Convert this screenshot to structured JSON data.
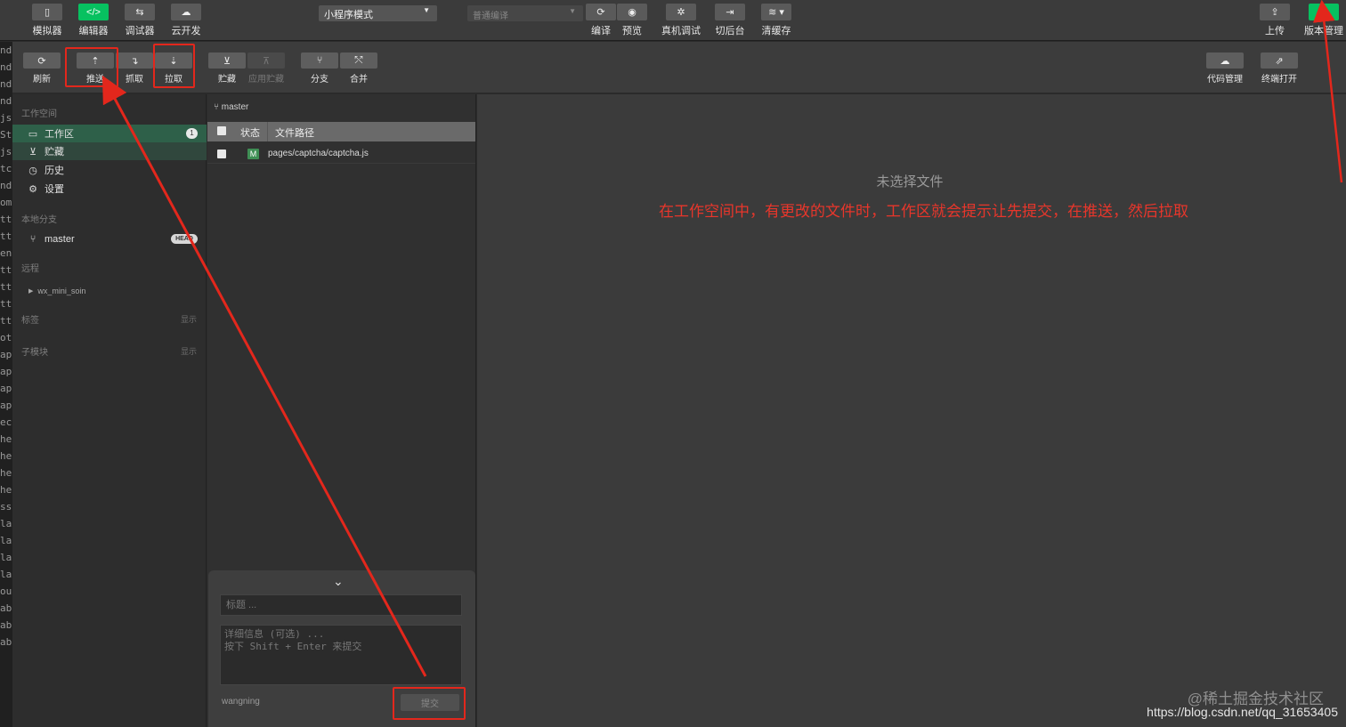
{
  "toolbar": {
    "simulator": "模拟器",
    "editor": "编辑器",
    "debugger": "调试器",
    "cloud": "云开发",
    "mode": "小程序模式",
    "compile_mode": "普通编译",
    "compile": "编译",
    "preview": "预览",
    "remote_debug": "真机调试",
    "background": "切后台",
    "clear_cache": "清缓存",
    "upload": "上传",
    "version": "版本管理"
  },
  "vcs_toolbar": {
    "refresh": "刷新",
    "push": "推送",
    "fetch": "抓取",
    "pull": "拉取",
    "stash": "贮藏",
    "apply_stash": "应用贮藏",
    "branch": "分支",
    "merge": "合并",
    "code_manage": "代码管理",
    "open_terminal": "终端打开"
  },
  "sidebar": {
    "workspace_title": "工作空间",
    "items": [
      {
        "label": "工作区",
        "badge": "1"
      },
      {
        "label": "贮藏"
      },
      {
        "label": "历史"
      },
      {
        "label": "设置"
      }
    ],
    "local_branch_title": "本地分支",
    "branch": {
      "label": "master",
      "tag": "HEAD"
    },
    "remote_title": "远程",
    "remote_item": "wx_mini_soin",
    "tags_title": "标签",
    "tags_action": "显示",
    "submodule_title": "子模块",
    "submodule_action": "显示"
  },
  "file_panel": {
    "branch": "master",
    "col_status": "状态",
    "col_path": "文件路径",
    "files": [
      {
        "status": "M",
        "path": "pages/captcha/captcha.js"
      }
    ]
  },
  "commit": {
    "title_placeholder": "标题 ...",
    "desc_placeholder": "详细信息 (可选) ...\n按下 Shift + Enter 来提交",
    "author": "wangning",
    "submit": "提交"
  },
  "main": {
    "empty": "未选择文件",
    "annotation": "在工作空间中，有更改的文件时，工作区就会提示让先提交，在推送，然后拉取"
  },
  "watermark": {
    "brand": "@稀土掘金技术社区",
    "url": "https://blog.csdn.net/qq_31653405"
  },
  "code_gutter": [
    "nd",
    "nd",
    "nd",
    "nd",
    "jsc",
    "Stu",
    "js",
    "tch",
    "nd",
    "om",
    "tte",
    "ttle",
    "en",
    "tte",
    "tte",
    "tte",
    "tte",
    "otc",
    "apt",
    "apt",
    "apt",
    "apt",
    "eck",
    "hec",
    "hec",
    "hec",
    "hec",
    "ssi",
    "las",
    "las",
    "las",
    "las",
    "ou",
    "abu",
    "abu",
    "abu"
  ],
  "colors": {
    "accent": "#07c160",
    "annotation": "#e8362b",
    "active_row": "#2e6049"
  }
}
